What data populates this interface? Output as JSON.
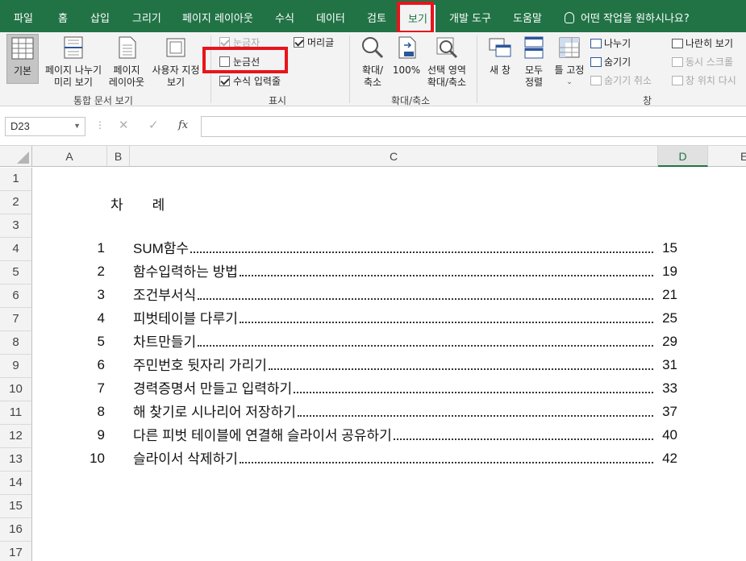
{
  "ribbon_tabs": [
    "파일",
    "홈",
    "삽입",
    "그리기",
    "페이지 레이아웃",
    "수식",
    "데이터",
    "검토",
    "보기",
    "개발 도구",
    "도움말"
  ],
  "tell_me": "어떤 작업을 원하시나요?",
  "groups": {
    "workbook_views": {
      "label": "통합 문서 보기",
      "normal": "기본",
      "page_break_l1": "페이지 나누기",
      "page_break_l2": "미리 보기",
      "page_layout_l1": "페이지",
      "page_layout_l2": "레이아웃",
      "custom_l1": "사용자 지정",
      "custom_l2": "보기"
    },
    "show": {
      "label": "표시",
      "ruler": "눈금자",
      "formula_bar": "수식 입력줄",
      "gridlines": "눈금선",
      "headings": "머리글"
    },
    "zoom": {
      "label": "확대/축소",
      "zoom_l1": "확대/",
      "zoom_l2": "축소",
      "hundred": "100%",
      "selection_l1": "선택 영역",
      "selection_l2": "확대/축소"
    },
    "window": {
      "label": "창",
      "new_window": "새 창",
      "arrange_l1": "모두",
      "arrange_l2": "정렬",
      "freeze": "틀 고정",
      "split": "나누기",
      "hide": "숨기기",
      "unhide": "숨기기 취소",
      "side_by_side": "나란히 보기",
      "sync_scroll": "동시 스크롤",
      "reset_pos": "창 위치 다시"
    }
  },
  "name_box": "D23",
  "fx_label": "fx",
  "columns": [
    "A",
    "B",
    "C",
    "D",
    "E"
  ],
  "rows": [
    "1",
    "2",
    "3",
    "4",
    "5",
    "6",
    "7",
    "8",
    "9",
    "10",
    "11",
    "12",
    "13",
    "14",
    "15",
    "16",
    "17"
  ],
  "toc_title": [
    "차",
    "례"
  ],
  "toc": [
    {
      "num": "1",
      "title": "SUM함수",
      "page": "15"
    },
    {
      "num": "2",
      "title": "함수입력하는 방법",
      "page": "19"
    },
    {
      "num": "3",
      "title": "조건부서식",
      "page": "21"
    },
    {
      "num": "4",
      "title": "피벗테이블 다루기",
      "page": "25"
    },
    {
      "num": "5",
      "title": "차트만들기",
      "page": "29"
    },
    {
      "num": "6",
      "title": "주민번호 뒷자리 가리기",
      "page": "31"
    },
    {
      "num": "7",
      "title": "경력증명서 만들고 입력하기",
      "page": "33"
    },
    {
      "num": "8",
      "title": "해 찾기로 시나리어 저장하기",
      "page": "37"
    },
    {
      "num": "9",
      "title": "다른 피벗 테이블에 연결해 슬라이서 공유하기",
      "page": "40"
    },
    {
      "num": "10",
      "title": "슬라이서 삭제하기",
      "page": "42"
    }
  ],
  "checkbox_states": {
    "ruler": true,
    "formula_bar": true,
    "gridlines": false,
    "headings": true
  },
  "colors": {
    "excel_green": "#217346",
    "highlight_red": "#e8141b"
  }
}
